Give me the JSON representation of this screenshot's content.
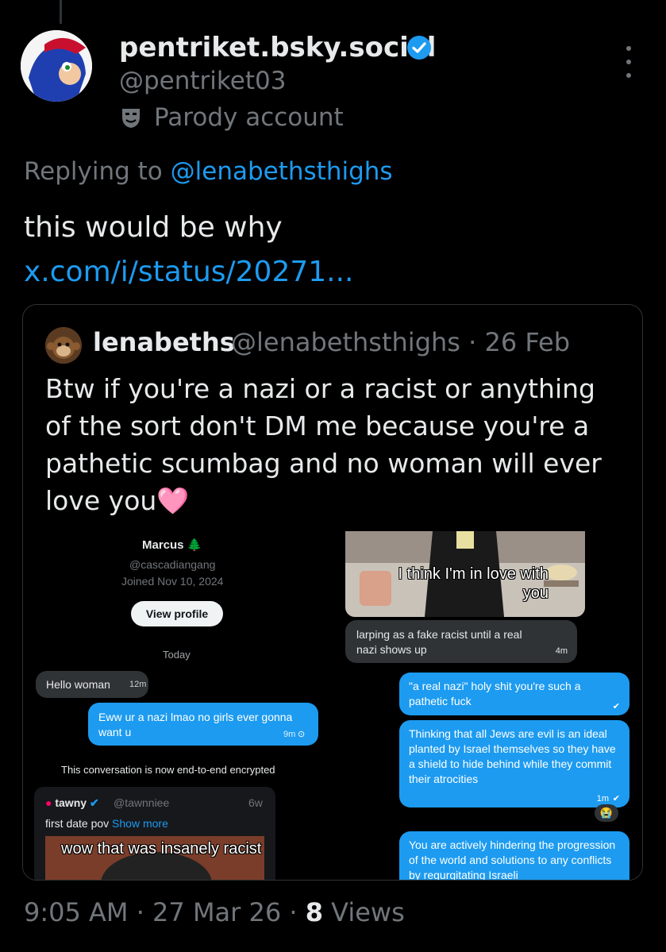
{
  "post": {
    "display_name": "pentriket.bsky.social",
    "handle": "@pentriket03",
    "parody_label": "Parody account",
    "replying_prefix": "Replying to",
    "replying_to": "@lenabethsthighs",
    "text": "this would be why",
    "link": "x.com/i/status/20271...",
    "time": "9:05 AM",
    "sep": "·",
    "date": "27 Mar 26",
    "views_count": "8",
    "views_label": "Views",
    "accent": "#1d9bf0"
  },
  "quote": {
    "name": "lenabeths",
    "handle": "@lenabethsthighs",
    "date": "26 Feb",
    "meta_sep": "·",
    "text": "Btw if you're a nazi or a racist or anything of the sort don't DM me because you're a pathetic scumbag and no woman will ever love you",
    "emoji": "🩷"
  },
  "left_screenshot": {
    "profile_name": "Marcus",
    "tree_emoji": "🌲",
    "profile_handle": "@cascadiangang",
    "joined": "Joined Nov 10, 2024",
    "view_profile": "View profile",
    "day": "Today",
    "msg1": {
      "text": "Hello woman",
      "time": "12m"
    },
    "msg2": {
      "text": "Eww ur a nazi lmao no girls ever gonna want u",
      "time": "9m"
    },
    "encrypted_notice": "This conversation is now end-to-end encrypted",
    "shared_post": {
      "name": "tawny",
      "handle": "@tawnniee",
      "time": "6w",
      "text": "first date pov",
      "show_more": "Show more",
      "caption": "wow that was insanely racist"
    }
  },
  "right_screenshot": {
    "caption": "I think I'm in love with you",
    "incoming": {
      "text": "larping as a fake racist until a real nazi shows up",
      "time": "4m"
    },
    "out1": "\"a real nazi\" holy shit you're such a pathetic fuck",
    "out2": "Thinking that all Jews are evil is an ideal planted by Israel themselves so they have a shield to hide behind while they commit their atrocities",
    "out2_time": "1m",
    "reaction": "😭",
    "out3": "You are actively hindering the progression of the world and solutions to any conflicts by regurgitating Israeli"
  }
}
